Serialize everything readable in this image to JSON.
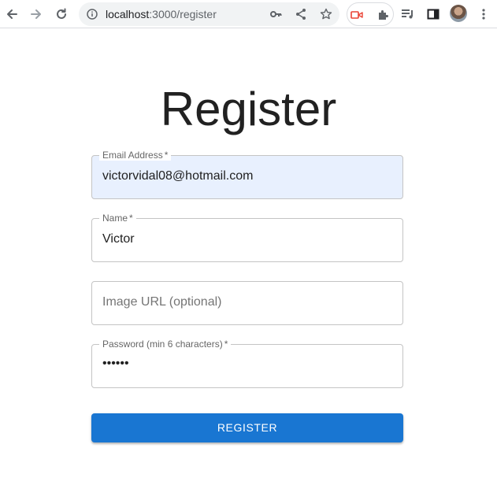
{
  "browser": {
    "url_host": "localhost",
    "url_path": ":3000/register",
    "icons": [
      "back-arrow-icon",
      "forward-arrow-icon",
      "reload-icon",
      "site-info-icon",
      "key-icon",
      "share-icon",
      "star-icon",
      "extension-recorder-icon",
      "puzzle-icon",
      "media-queue-icon",
      "side-panel-icon",
      "avatar",
      "kebab-menu-icon"
    ]
  },
  "page": {
    "title": "Register",
    "fields": [
      {
        "label": "Email Address",
        "required": "*",
        "value": "victorvidal08@hotmail.com"
      },
      {
        "label": "Name",
        "required": "*",
        "value": "Victor"
      },
      {
        "placeholder": "Image URL (optional)"
      },
      {
        "label": "Password (min 6 characters)",
        "required": "*",
        "masked_value": "••••••"
      }
    ],
    "submit_label": "REGISTER"
  },
  "colors": {
    "primary": "#1976d2",
    "autofill_bg": "#e8f0fe",
    "border": "#c4c4c4"
  }
}
